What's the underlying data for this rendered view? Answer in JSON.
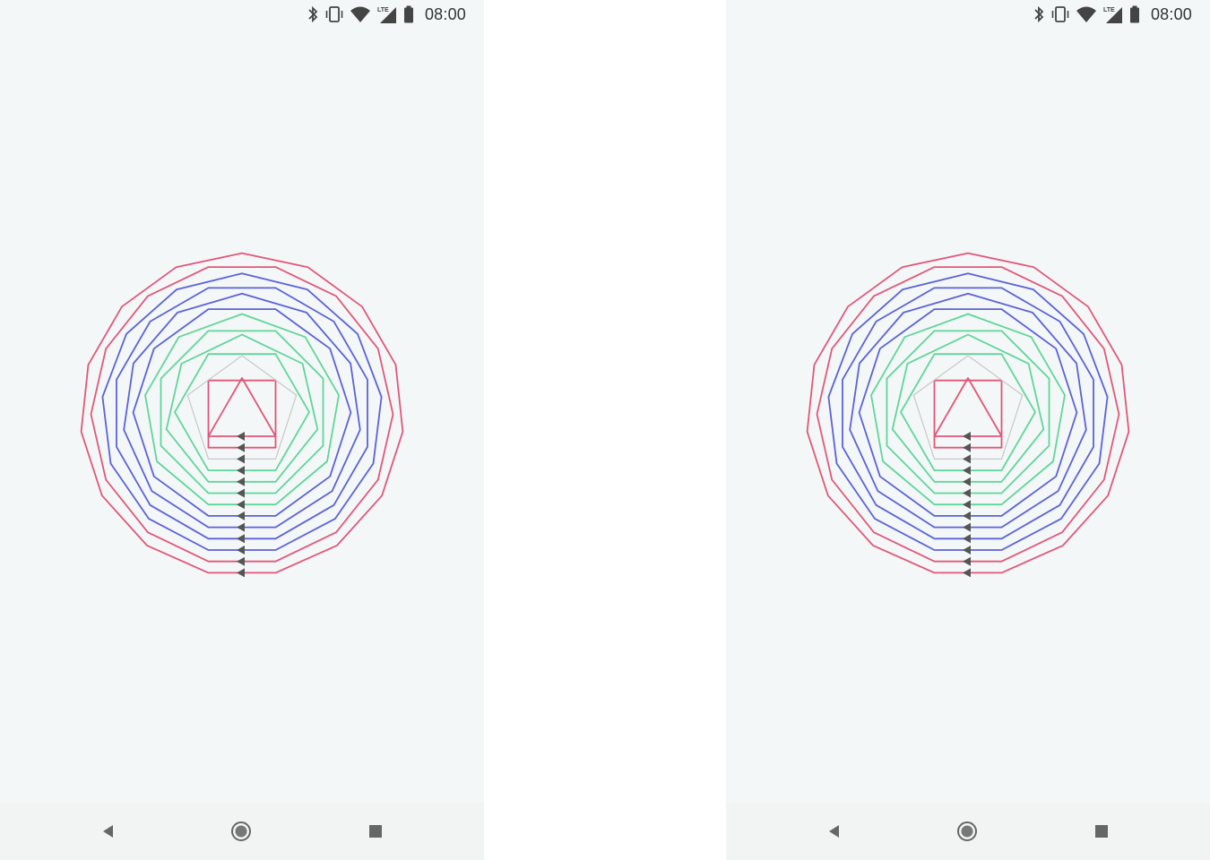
{
  "screens": [
    {
      "status_bar": {
        "time": "08:00",
        "icons": [
          "bluetooth-icon",
          "vibrate-icon",
          "wifi-icon",
          "lte-signal-icon",
          "battery-icon"
        ],
        "network_label": "LTE"
      },
      "navigation": {
        "buttons": [
          "back-button",
          "home-button",
          "recents-button"
        ]
      }
    },
    {
      "status_bar": {
        "time": "08:00",
        "icons": [
          "bluetooth-icon",
          "vibrate-icon",
          "wifi-icon",
          "lte-signal-icon",
          "battery-icon"
        ],
        "network_label": "LTE"
      },
      "navigation": {
        "buttons": [
          "back-button",
          "home-button",
          "recents-button"
        ]
      }
    }
  ],
  "pattern": {
    "description_shapes": [
      {
        "sides": 3,
        "color": "#e0577a"
      },
      {
        "sides": 4,
        "color": "#e0577a"
      },
      {
        "sides": 5,
        "color": "#c8c8c8"
      },
      {
        "sides": 6,
        "color": "#5ed69a"
      },
      {
        "sides": 7,
        "color": "#5ed69a"
      },
      {
        "sides": 8,
        "color": "#5ed69a"
      },
      {
        "sides": 9,
        "color": "#5ed69a"
      },
      {
        "sides": 10,
        "color": "#5a62d8"
      },
      {
        "sides": 11,
        "color": "#5a62d8"
      },
      {
        "sides": 12,
        "color": "#5a62d8"
      },
      {
        "sides": 13,
        "color": "#5a62d8"
      },
      {
        "sides": 14,
        "color": "#e0577a"
      },
      {
        "sides": 15,
        "color": "#e0577a"
      }
    ],
    "marker_color": "#555555"
  },
  "colors": {
    "screen_background": "#f4f7f7",
    "status_text": "#333333",
    "nav_icon": "#666666"
  }
}
